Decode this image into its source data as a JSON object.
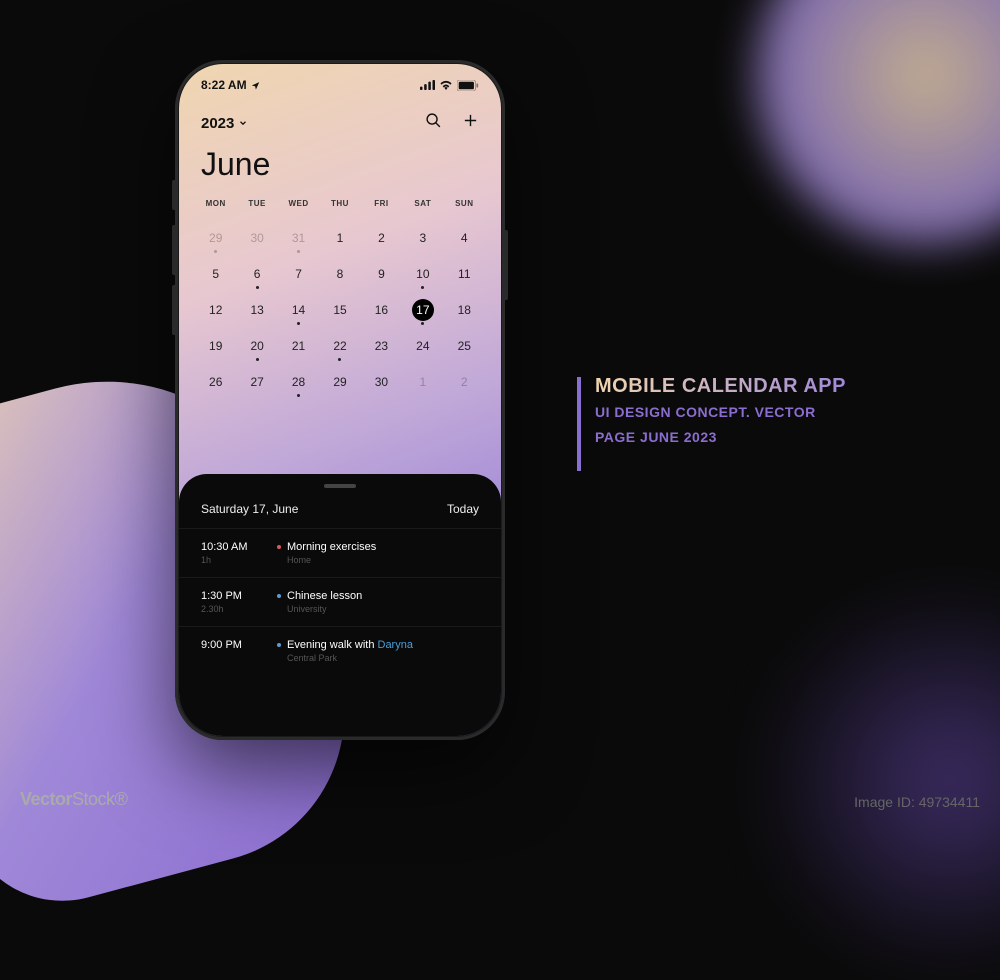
{
  "statusbar": {
    "time": "8:22 AM"
  },
  "header": {
    "year": "2023"
  },
  "month": "June",
  "weekdays": [
    "MON",
    "TUE",
    "WED",
    "THU",
    "FRI",
    "SAT",
    "SUN"
  ],
  "days": [
    {
      "n": "29",
      "muted": true,
      "dot": true
    },
    {
      "n": "30",
      "muted": true,
      "dot": false
    },
    {
      "n": "31",
      "muted": true,
      "dot": true
    },
    {
      "n": "1",
      "muted": false,
      "dot": false
    },
    {
      "n": "2",
      "muted": false,
      "dot": false
    },
    {
      "n": "3",
      "muted": false,
      "dot": false
    },
    {
      "n": "4",
      "muted": false,
      "dot": false
    },
    {
      "n": "5",
      "muted": false,
      "dot": false
    },
    {
      "n": "6",
      "muted": false,
      "dot": true
    },
    {
      "n": "7",
      "muted": false,
      "dot": false
    },
    {
      "n": "8",
      "muted": false,
      "dot": false
    },
    {
      "n": "9",
      "muted": false,
      "dot": false
    },
    {
      "n": "10",
      "muted": false,
      "dot": true
    },
    {
      "n": "11",
      "muted": false,
      "dot": false
    },
    {
      "n": "12",
      "muted": false,
      "dot": false
    },
    {
      "n": "13",
      "muted": false,
      "dot": false
    },
    {
      "n": "14",
      "muted": false,
      "dot": true
    },
    {
      "n": "15",
      "muted": false,
      "dot": false
    },
    {
      "n": "16",
      "muted": false,
      "dot": false
    },
    {
      "n": "17",
      "muted": false,
      "dot": true,
      "selected": true
    },
    {
      "n": "18",
      "muted": false,
      "dot": false
    },
    {
      "n": "19",
      "muted": false,
      "dot": false
    },
    {
      "n": "20",
      "muted": false,
      "dot": true
    },
    {
      "n": "21",
      "muted": false,
      "dot": false
    },
    {
      "n": "22",
      "muted": false,
      "dot": true
    },
    {
      "n": "23",
      "muted": false,
      "dot": false
    },
    {
      "n": "24",
      "muted": false,
      "dot": false
    },
    {
      "n": "25",
      "muted": false,
      "dot": false
    },
    {
      "n": "26",
      "muted": false,
      "dot": false
    },
    {
      "n": "27",
      "muted": false,
      "dot": false
    },
    {
      "n": "28",
      "muted": false,
      "dot": true
    },
    {
      "n": "29",
      "muted": false,
      "dot": false
    },
    {
      "n": "30",
      "muted": false,
      "dot": false
    },
    {
      "n": "1",
      "muted": true,
      "dot": false
    },
    {
      "n": "2",
      "muted": true,
      "dot": false
    }
  ],
  "agenda": {
    "date_label": "Saturday 17, June",
    "today_label": "Today",
    "events": [
      {
        "time": "10:30 AM",
        "duration": "1h",
        "dot": "#d85a5a",
        "title": "Morning exercises",
        "mention": "",
        "location": "Home"
      },
      {
        "time": "1:30 PM",
        "duration": "2.30h",
        "dot": "#5a9ad8",
        "title": "Chinese lesson",
        "mention": "",
        "location": "University"
      },
      {
        "time": "9:00 PM",
        "duration": "",
        "dot": "#5a9ad8",
        "title": "Evening walk with ",
        "mention": "Daryna",
        "location": "Central Park"
      }
    ]
  },
  "promo": {
    "title": "MOBILE CALENDAR APP",
    "line1": "UI DESIGN CONCEPT. VECTOR",
    "line2": "PAGE JUNE 2023"
  },
  "watermark": {
    "brand_a": "Vector",
    "brand_b": "Stock",
    "id": "Image ID: 49734411"
  },
  "colors": {
    "accent": "#8b6dd0"
  }
}
